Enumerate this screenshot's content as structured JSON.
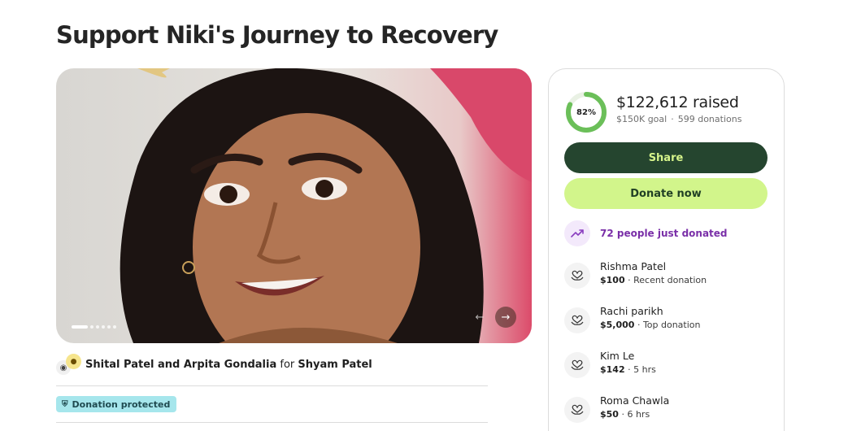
{
  "page": {
    "title": "Support Niki's Journey to Recovery"
  },
  "gallery": {
    "slide_count": 7,
    "active_slide": 1,
    "prev_icon": "arrow-left-icon",
    "next_icon": "arrow-right-icon"
  },
  "organizer": {
    "names": "Shital Patel and Arpita Gondalia",
    "for_word": "for",
    "beneficiary": "Shyam Patel"
  },
  "badges": {
    "protected_label": "Donation protected"
  },
  "progress": {
    "percent_label": "82%",
    "fraction": 0.82,
    "raised": "$122,612 raised",
    "goal": "$150K goal",
    "separator": "·",
    "donations": "599 donations"
  },
  "actions": {
    "share_label": "Share",
    "donate_label": "Donate now"
  },
  "activity": {
    "trend_text": "72 people just donated",
    "donors": [
      {
        "name": "Rishma Patel",
        "amount": "$100",
        "note": " · Recent donation"
      },
      {
        "name": "Rachi parikh",
        "amount": "$5,000",
        "note": " · Top donation"
      },
      {
        "name": "Kim Le",
        "amount": "$142",
        "note": " · 5 hrs"
      },
      {
        "name": "Roma Chawla",
        "amount": "$50",
        "note": " · 6 hrs"
      }
    ]
  },
  "colors": {
    "brand_dark": "#25452f",
    "brand_light": "#d2f58b",
    "progress_ring": "#6bbf59",
    "trend_purple": "#7a2fa8",
    "protected_bg": "#a6e6ec"
  }
}
